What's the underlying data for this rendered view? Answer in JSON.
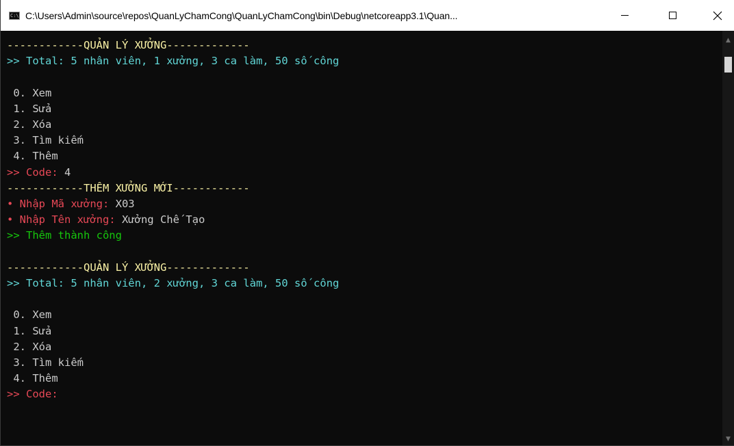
{
  "window": {
    "title": "C:\\Users\\Admin\\source\\repos\\QuanLyChamCong\\QuanLyChamCong\\bin\\Debug\\netcoreapp3.1\\Quan...",
    "icon_text": "C:\\"
  },
  "console": {
    "lines": [
      {
        "text": "------------QUẢN LÝ XƯỞNG-------------",
        "color": "yellow"
      },
      {
        "text": ">> Total: 5 nhân viên, 1 xưởng, 3 ca làm, 50 số công",
        "color": "cyan"
      },
      {
        "text": "",
        "color": "white"
      },
      {
        "text": " 0. Xem",
        "color": "white"
      },
      {
        "text": " 1. Sửa",
        "color": "white"
      },
      {
        "text": " 2. Xóa",
        "color": "white"
      },
      {
        "text": " 3. Tìm kiếm",
        "color": "white"
      },
      {
        "text": " 4. Thêm",
        "color": "white"
      },
      {
        "segments": [
          {
            "text": ">> Code: ",
            "color": "red"
          },
          {
            "text": "4",
            "color": "white"
          }
        ]
      },
      {
        "text": "------------THÊM XƯỞNG MỚI------------",
        "color": "yellow"
      },
      {
        "segments": [
          {
            "text": "• Nhập Mã xưởng: ",
            "color": "red"
          },
          {
            "text": "X03",
            "color": "white"
          }
        ]
      },
      {
        "segments": [
          {
            "text": "• Nhập Tên xưởng: ",
            "color": "red"
          },
          {
            "text": "Xưởng Chế Tạo",
            "color": "white"
          }
        ]
      },
      {
        "text": ">> Thêm thành công",
        "color": "green"
      },
      {
        "text": "",
        "color": "white"
      },
      {
        "text": "------------QUẢN LÝ XƯỞNG-------------",
        "color": "yellow"
      },
      {
        "text": ">> Total: 5 nhân viên, 2 xưởng, 3 ca làm, 50 số công",
        "color": "cyan"
      },
      {
        "text": "",
        "color": "white"
      },
      {
        "text": " 0. Xem",
        "color": "white"
      },
      {
        "text": " 1. Sửa",
        "color": "white"
      },
      {
        "text": " 2. Xóa",
        "color": "white"
      },
      {
        "text": " 3. Tìm kiếm",
        "color": "white"
      },
      {
        "text": " 4. Thêm",
        "color": "white"
      },
      {
        "segments": [
          {
            "text": ">> Code: ",
            "color": "red"
          }
        ]
      }
    ]
  },
  "icons": {
    "minimize": "minimize-icon",
    "maximize": "maximize-icon",
    "close": "close-icon",
    "scroll_up": "scroll-up-arrow-icon",
    "scroll_down": "scroll-down-arrow-icon"
  },
  "colors": {
    "background": "#0c0c0c",
    "yellow": "#f9f1a5",
    "cyan": "#61d6d6",
    "white": "#cccccc",
    "red": "#e74856",
    "green": "#16c60c"
  }
}
